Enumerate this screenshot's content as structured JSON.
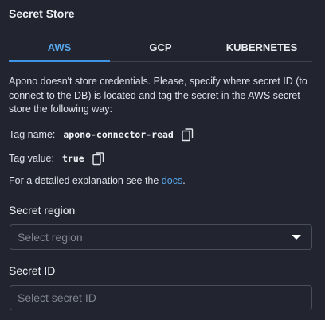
{
  "section_title": "Secret Store",
  "tabs": [
    {
      "label": "AWS",
      "active": true
    },
    {
      "label": "GCP",
      "active": false
    },
    {
      "label": "KUBERNETES",
      "active": false
    }
  ],
  "description": "Apono doesn't store credentials. Please, specify where secret ID (to connect to the DB) is located and tag the secret in the AWS secret store the following way:",
  "tag_name": {
    "label": "Tag name:",
    "value": "apono-connector-read",
    "icon": "copy-icon"
  },
  "tag_value": {
    "label": "Tag value:",
    "value": "true",
    "icon": "copy-icon"
  },
  "explanation": {
    "text": "For a detailed explanation see the ",
    "link": "docs",
    "suffix": "."
  },
  "secret_region": {
    "label": "Secret region",
    "placeholder": "Select region",
    "icon": "caret-down-icon"
  },
  "secret_id": {
    "label": "Secret ID",
    "placeholder": "Select secret ID"
  },
  "colors": {
    "accent": "#3f94e6",
    "background": "#222530",
    "border": "#4a4e5c"
  }
}
